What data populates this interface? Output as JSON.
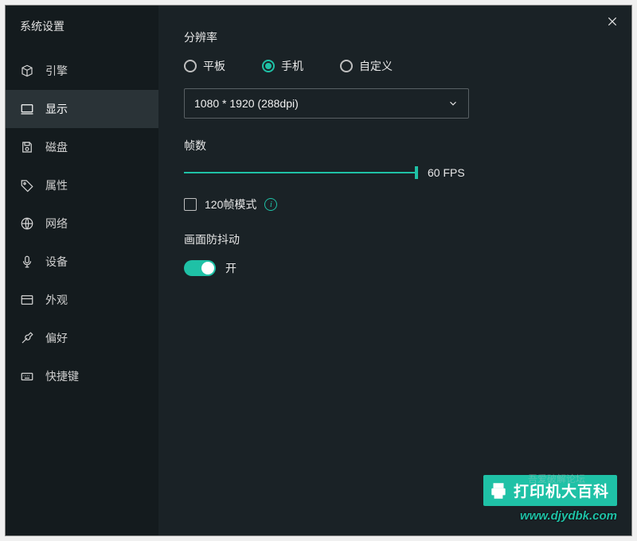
{
  "window": {
    "title": "系统设置"
  },
  "sidebar": {
    "items": [
      {
        "key": "engine",
        "label": "引擎",
        "icon": "cube-icon"
      },
      {
        "key": "display",
        "label": "显示",
        "icon": "monitor-icon",
        "active": true
      },
      {
        "key": "disk",
        "label": "磁盘",
        "icon": "save-icon"
      },
      {
        "key": "attrs",
        "label": "属性",
        "icon": "tag-icon"
      },
      {
        "key": "network",
        "label": "网络",
        "icon": "globe-icon"
      },
      {
        "key": "device",
        "label": "设备",
        "icon": "mic-icon"
      },
      {
        "key": "appearance",
        "label": "外观",
        "icon": "window-icon"
      },
      {
        "key": "prefs",
        "label": "偏好",
        "icon": "wrench-icon"
      },
      {
        "key": "shortcuts",
        "label": "快捷键",
        "icon": "keyboard-icon"
      }
    ]
  },
  "display": {
    "resolution": {
      "label": "分辨率",
      "options": [
        {
          "key": "tablet",
          "label": "平板"
        },
        {
          "key": "phone",
          "label": "手机"
        },
        {
          "key": "custom",
          "label": "自定义"
        }
      ],
      "selected": "phone",
      "dropdown_value": "1080 * 1920 (288dpi)"
    },
    "fps": {
      "label": "帧数",
      "value_text": "60 FPS",
      "value": 60,
      "max": 60,
      "mode120": {
        "label": "120帧模式",
        "checked": false
      }
    },
    "antishake": {
      "label": "画面防抖动",
      "state_label": "开",
      "on": true
    }
  },
  "watermark": {
    "main": "打印机大百科",
    "url": "www.djydbk.com",
    "forum": "吾爱破解论坛"
  },
  "colors": {
    "accent": "#1fc1a6",
    "bg": "#1a2226",
    "sidebar": "#141b1e"
  }
}
